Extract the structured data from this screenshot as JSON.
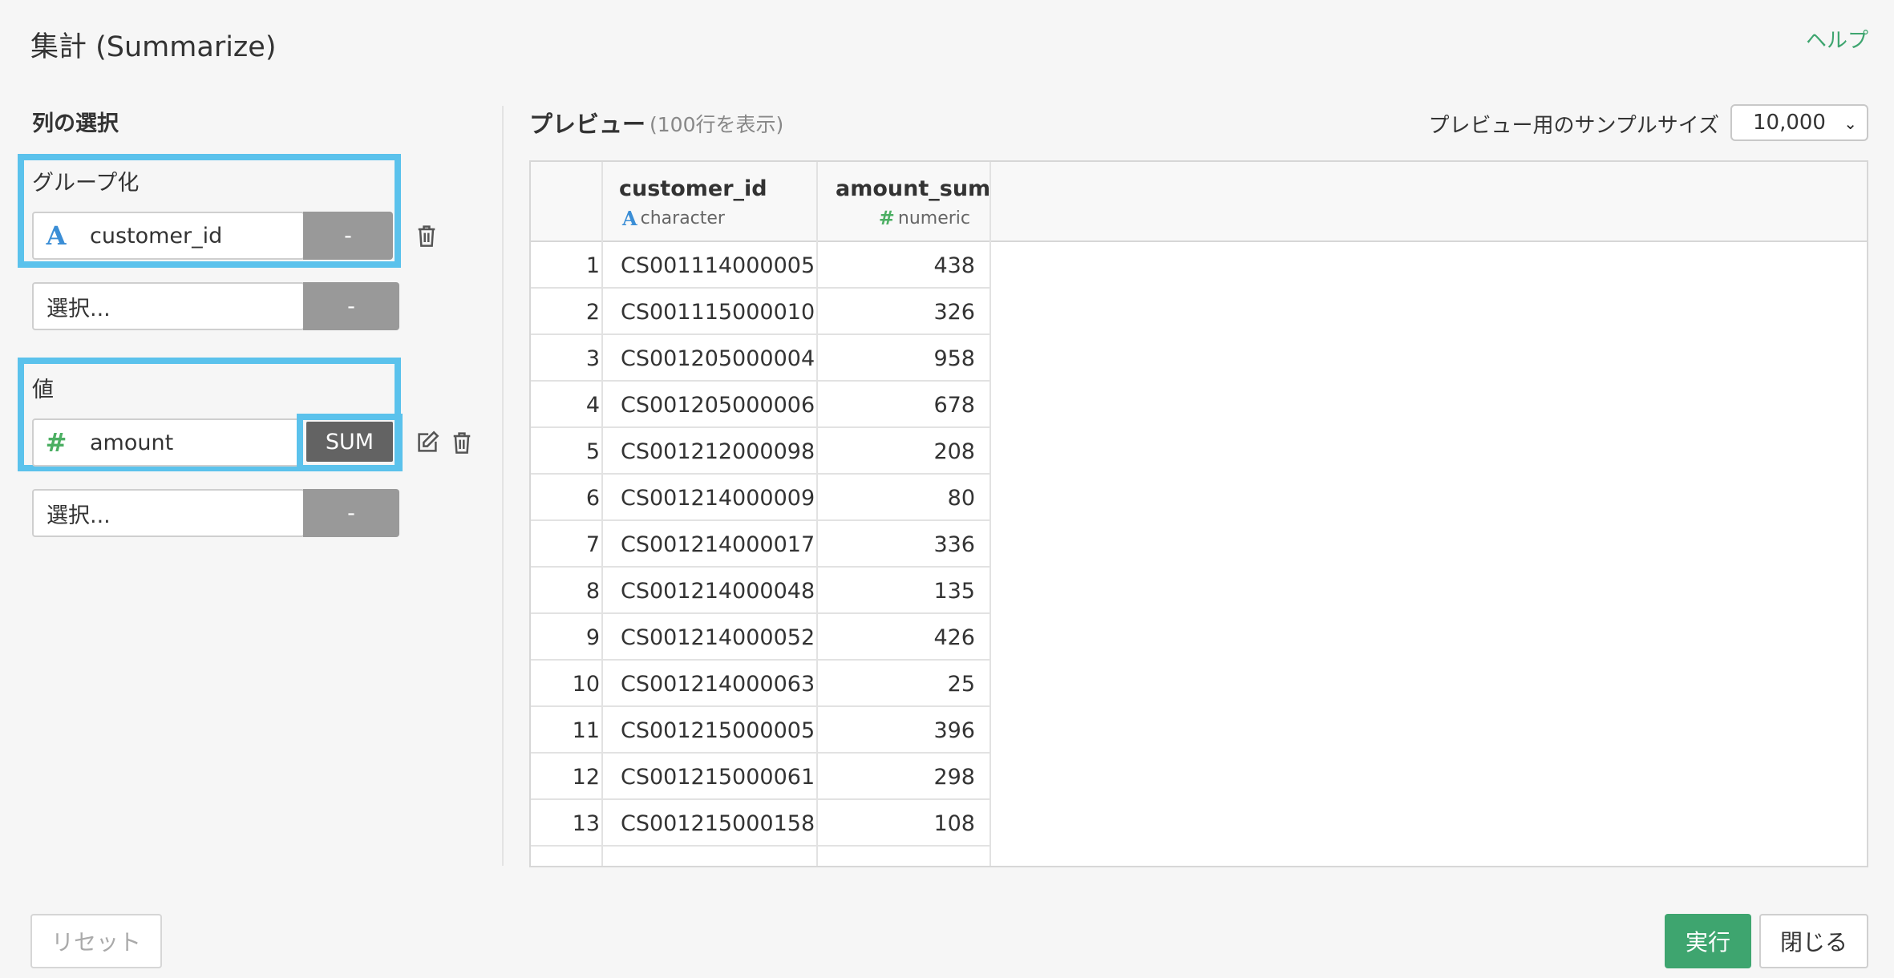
{
  "dialog": {
    "title": "集計 (Summarize)",
    "help_link": "ヘルプ"
  },
  "left_panel": {
    "heading": "列の選択",
    "group_section": {
      "label": "グループ化",
      "selected_field": {
        "icon": "character-type-icon",
        "name": "customer_id",
        "action": "-"
      },
      "empty_field": {
        "placeholder": "選択...",
        "action": "-"
      }
    },
    "value_section": {
      "label": "値",
      "selected_field": {
        "icon": "numeric-type-icon",
        "name": "amount",
        "action": "SUM"
      },
      "empty_field": {
        "placeholder": "選択...",
        "action": "-"
      }
    }
  },
  "preview": {
    "title": "プレビュー",
    "subtitle": "(100行を表示)",
    "sample_size_label": "プレビュー用のサンプルサイズ",
    "sample_size_value": "10,000",
    "columns": [
      {
        "name": "customer_id",
        "type": "character"
      },
      {
        "name": "amount_sum",
        "type": "numeric"
      }
    ],
    "rows": [
      {
        "n": "1",
        "customer_id": "CS001114000005",
        "amount_sum": "438"
      },
      {
        "n": "2",
        "customer_id": "CS001115000010",
        "amount_sum": "326"
      },
      {
        "n": "3",
        "customer_id": "CS001205000004",
        "amount_sum": "958"
      },
      {
        "n": "4",
        "customer_id": "CS001205000006",
        "amount_sum": "678"
      },
      {
        "n": "5",
        "customer_id": "CS001212000098",
        "amount_sum": "208"
      },
      {
        "n": "6",
        "customer_id": "CS001214000009",
        "amount_sum": "80"
      },
      {
        "n": "7",
        "customer_id": "CS001214000017",
        "amount_sum": "336"
      },
      {
        "n": "8",
        "customer_id": "CS001214000048",
        "amount_sum": "135"
      },
      {
        "n": "9",
        "customer_id": "CS001214000052",
        "amount_sum": "426"
      },
      {
        "n": "10",
        "customer_id": "CS001214000063",
        "amount_sum": "25"
      },
      {
        "n": "11",
        "customer_id": "CS001215000005",
        "amount_sum": "396"
      },
      {
        "n": "12",
        "customer_id": "CS001215000061",
        "amount_sum": "298"
      },
      {
        "n": "13",
        "customer_id": "CS001215000158",
        "amount_sum": "108"
      }
    ]
  },
  "footer": {
    "reset_label": "リセット",
    "run_label": "実行",
    "close_label": "閉じる"
  },
  "colors": {
    "accent_green": "#3ea56f",
    "highlight_blue": "#5bc2ec"
  }
}
